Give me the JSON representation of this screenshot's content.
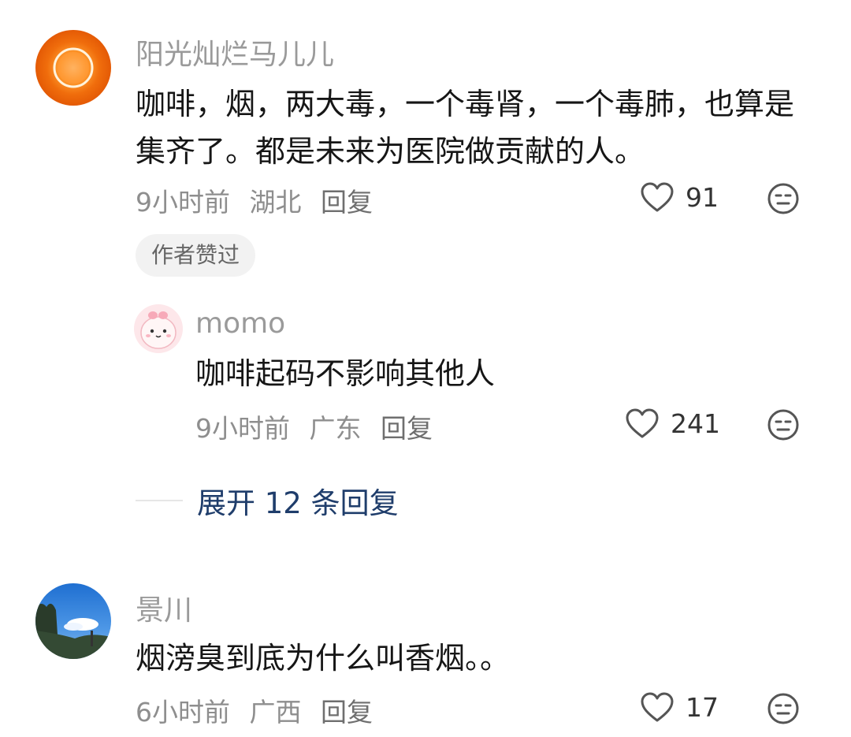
{
  "comments": [
    {
      "username": "阳光灿烂马儿儿",
      "text": "咖啡，烟，两大毒，一个毒肾，一个毒肺，也算是集齐了。都是未来为医院做贡献的人。",
      "time": "9小时前",
      "location": "湖北",
      "reply_label": "回复",
      "likes": "91",
      "badge": "作者赞过",
      "replies": [
        {
          "username": "momo",
          "text": "咖啡起码不影响其他人",
          "time": "9小时前",
          "location": "广东",
          "reply_label": "回复",
          "likes": "241"
        }
      ],
      "expand_label": "展开 12 条回复"
    },
    {
      "username": "景川",
      "text": "烟滂臭到底为什么叫香烟。。",
      "time": "6小时前",
      "location": "广西",
      "reply_label": "回复",
      "likes": "17"
    }
  ],
  "icons": {
    "like": "heart-outline-icon",
    "dislike": "neutral-face-icon"
  },
  "colors": {
    "link": "#1f3d6b",
    "meta": "#8e8e8e",
    "badge_bg": "#f2f2f2"
  }
}
